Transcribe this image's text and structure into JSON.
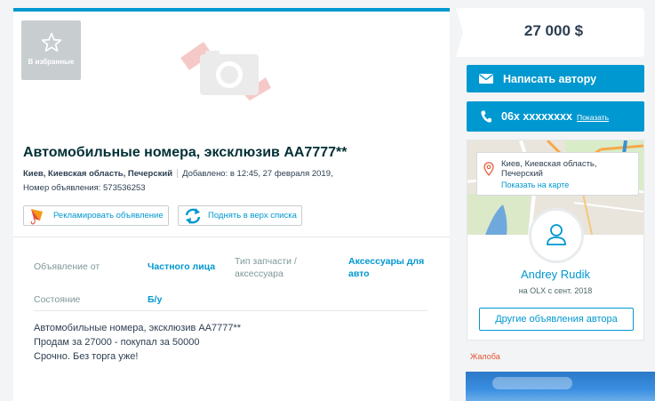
{
  "favorite": {
    "label": "В избранные",
    "icon": "star-icon"
  },
  "ad": {
    "title": "Автомобильные номера, эксклюзив АА7777**",
    "location": "Киев, Киевская область, Печерский",
    "added": "Добавлено: в 12:45, 27 февраля 2019,",
    "number": "Номер объявления: 573536253"
  },
  "actions": {
    "promote": "Рекламировать объявление",
    "raise": "Поднять в верх списка"
  },
  "props": {
    "type_label": "Объявление от",
    "type_value": "Частного лица",
    "parts_label_1": "Тип запчасти /",
    "parts_label_2": "аксессуара",
    "parts_value_1": "Аксессуары для",
    "parts_value_2": "авто",
    "state_label": "Состояние",
    "state_value": "Б/у"
  },
  "description": [
    "Автомобильные номера, эксклюзив АА7777**",
    "Продам за 27000 - покупал за 50000",
    "Срочно. Без торга уже!"
  ],
  "sidebar": {
    "price": "27 000 $",
    "write_label": "Написать автору",
    "phone": "06x xxxxxxxx",
    "phone_show": "Показать",
    "map_address_1": "Киев, Киевская область,",
    "map_address_2": "Печерский",
    "map_link": "Показать на карте",
    "seller_name": "Andrey Rudik",
    "seller_since": "на OLX с сент. 2018",
    "other_ads": "Другие объявления автора",
    "complain": "Жалоба"
  },
  "colors": {
    "accent": "#0098d0",
    "complain": "#e3542f"
  }
}
